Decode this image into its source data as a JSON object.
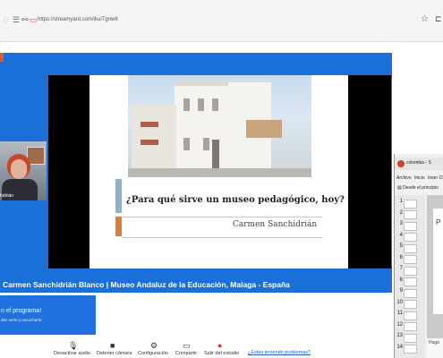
{
  "browser": {
    "url": "https://streamyard.com/ikuiTgnw6"
  },
  "slide": {
    "title": "¿Para qué sirve un museo pedagógico, hoy?",
    "author": "Carmen Sanchidrián"
  },
  "camera": {
    "name": "hidrián"
  },
  "caption": {
    "text": "Carmen Sanchidrián Blanco | Museo Andaluz de la Educación, Malaga - España"
  },
  "banner": {
    "title": "n el programa!",
    "subtitle": "den verte y escucharte"
  },
  "controls": {
    "items": [
      {
        "label": "Desactivar audio",
        "icon": "microphone-icon"
      },
      {
        "label": "Detener cámara",
        "icon": "camera-icon"
      },
      {
        "label": "Configuración",
        "icon": "gear-icon"
      },
      {
        "label": "Compartir",
        "icon": "screen-share-icon"
      },
      {
        "label": "Salir del estudio",
        "icon": "leave-icon"
      }
    ],
    "help": "¿Estás teniendo problemas?"
  },
  "presentation_app": {
    "title": "colombia - S",
    "menu": [
      "Archivo",
      "Inicio",
      "Inser",
      "D"
    ],
    "toolbar": "Desde el principio",
    "slide_numbers": [
      "1",
      "2",
      "3",
      "4",
      "5",
      "6",
      "7",
      "8",
      "9",
      "10",
      "11",
      "12",
      "13",
      "14"
    ],
    "slide_letter": "P",
    "notes_placeholder": "Haga"
  },
  "colors": {
    "stage": "#1a6fd8",
    "title_accent": "#8fb0cf",
    "author_accent": "#e07a3e",
    "leave_red": "#e0332f"
  }
}
